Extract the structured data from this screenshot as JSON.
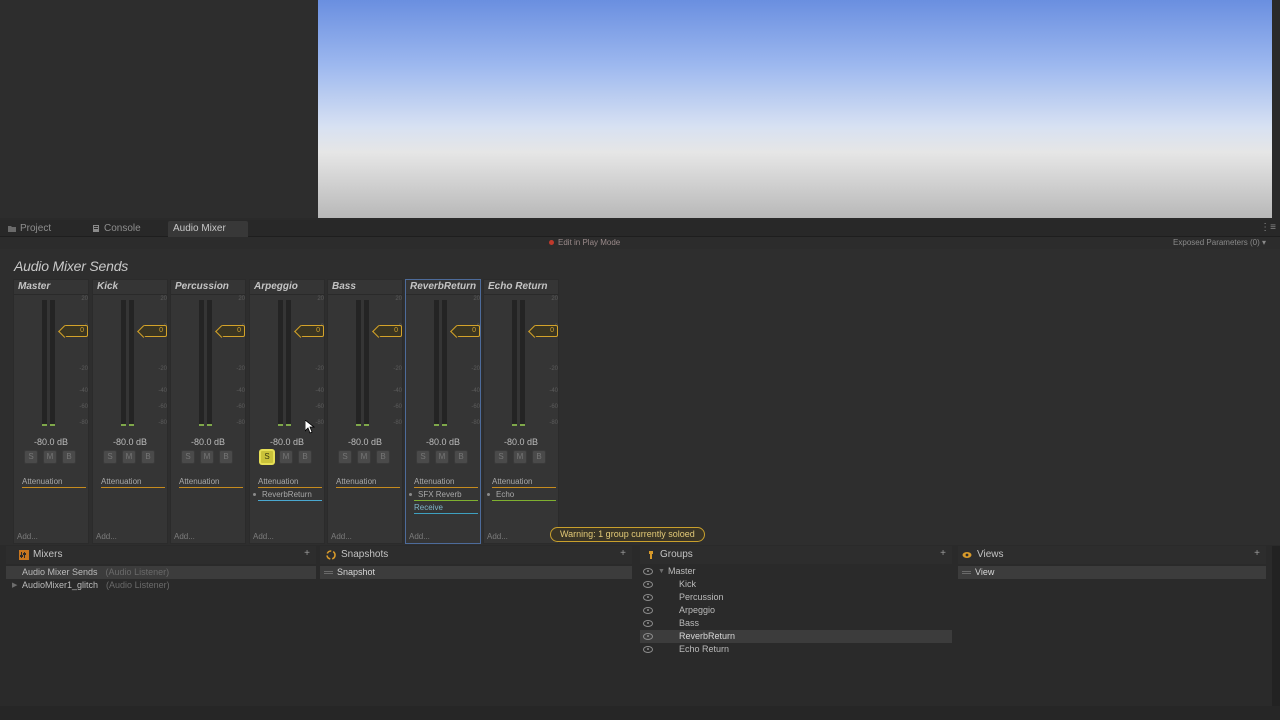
{
  "tabs": [
    {
      "label": "Project",
      "icon": "folder-icon"
    },
    {
      "label": "Console",
      "icon": "console-icon"
    },
    {
      "label": "Audio Mixer",
      "icon": ""
    }
  ],
  "tab_menu_glyph": "⋮≡",
  "toolbar": {
    "play_mode_label": "Edit in Play Mode",
    "exposed_params_label": "Exposed Parameters (0) ▾"
  },
  "mixer": {
    "title": "Audio Mixer Sends",
    "scale_labels": [
      "20",
      "0",
      "-20",
      "-40",
      "-60",
      "-80"
    ],
    "strips": [
      {
        "name": "Master",
        "level": "-80.0 dB",
        "fader": "0",
        "solo": "S",
        "mute": "M",
        "bypass": "B",
        "effects": [
          "Attenuation"
        ],
        "add": "Add..."
      },
      {
        "name": "Kick",
        "level": "-80.0 dB",
        "fader": "0",
        "solo": "S",
        "mute": "M",
        "bypass": "B",
        "effects": [
          "Attenuation"
        ],
        "add": "Add..."
      },
      {
        "name": "Percussion",
        "level": "-80.0 dB",
        "fader": "0",
        "solo": "S",
        "mute": "M",
        "bypass": "B",
        "effects": [
          "Attenuation"
        ],
        "add": "Add..."
      },
      {
        "name": "Arpeggio",
        "level": "-80.0 dB",
        "fader": "0",
        "solo": "S",
        "mute": "M",
        "bypass": "B",
        "effects": [
          "Attenuation",
          "ReverbReturn"
        ],
        "add": "Add..."
      },
      {
        "name": "Bass",
        "level": "-80.0 dB",
        "fader": "0",
        "solo": "S",
        "mute": "M",
        "bypass": "B",
        "effects": [
          "Attenuation"
        ],
        "add": "Add..."
      },
      {
        "name": "ReverbReturn",
        "level": "-80.0 dB",
        "fader": "0",
        "solo": "S",
        "mute": "M",
        "bypass": "B",
        "effects": [
          "Attenuation",
          "SFX Reverb",
          "Receive"
        ],
        "add": "Add..."
      },
      {
        "name": "Echo Return",
        "level": "-80.0 dB",
        "fader": "0",
        "solo": "S",
        "mute": "M",
        "bypass": "B",
        "effects": [
          "Attenuation",
          "Echo"
        ],
        "add": "Add..."
      }
    ],
    "soloed_strip": "Arpeggio",
    "selected_strip": "ReverbReturn",
    "warning": "Warning: 1 group currently soloed"
  },
  "panes": {
    "mixers": {
      "title": "Mixers",
      "add": "+",
      "items": [
        {
          "name": "Audio Mixer Sends",
          "output": "(Audio Listener)"
        },
        {
          "name": "AudioMixer1_glitch",
          "output": "(Audio Listener)"
        }
      ]
    },
    "snapshots": {
      "title": "Snapshots",
      "add": "+",
      "items": [
        "Snapshot"
      ]
    },
    "groups": {
      "title": "Groups",
      "add": "+",
      "items": [
        "Master",
        "Kick",
        "Percussion",
        "Arpeggio",
        "Bass",
        "ReverbReturn",
        "Echo Return"
      ],
      "selected": "ReverbReturn"
    },
    "views": {
      "title": "Views",
      "add": "+",
      "items": [
        "View"
      ]
    }
  },
  "colors": {
    "fader_accent": "#d4a32a",
    "solo_active": "#c9c23a",
    "selected_border": "#4d6b9a",
    "send_green": "#7fb030",
    "receive_blue": "#3ea0c0"
  }
}
